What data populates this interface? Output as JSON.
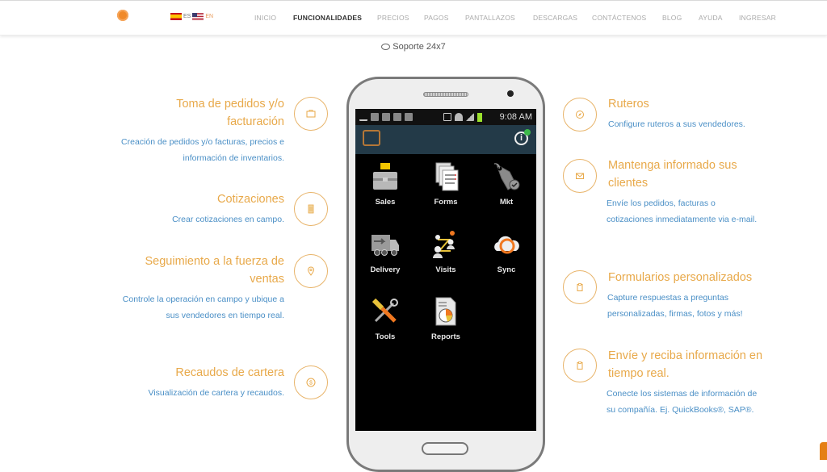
{
  "header": {
    "lang_es": "ES",
    "lang_en": "EN",
    "nav": [
      {
        "label": "INICIO",
        "active": false
      },
      {
        "label": "FUNCIONALIDADES",
        "active": true
      },
      {
        "label": "PRECIOS",
        "active": false
      },
      {
        "label": "PAGOS",
        "active": false
      },
      {
        "label": "PANTALLAZOS",
        "active": false
      },
      {
        "label": "DESCARGAS",
        "active": false
      },
      {
        "label": "CONTÁCTENOS",
        "active": false
      },
      {
        "label": "BLOG",
        "active": false
      },
      {
        "label": "AYUDA",
        "active": false
      },
      {
        "label": "INGRESAR",
        "active": false
      }
    ]
  },
  "support": {
    "label": "Soporte 24x7",
    "icon": "chat-bubble-icon"
  },
  "features_left": [
    {
      "title": "Toma de pedidos y/o facturación",
      "desc": "Creación de pedidos y/o facturas, precios e información de inventarios.",
      "icon": "briefcase-icon"
    },
    {
      "title": "Cotizaciones",
      "desc": "Crear cotizaciones en campo.",
      "icon": "calculator-icon"
    },
    {
      "title": "Seguimiento a la fuerza de ventas",
      "desc": "Controle la operación en campo y ubique a sus vendedores en tiempo real.",
      "icon": "map-pin-icon"
    },
    {
      "title": "Recaudos de cartera",
      "desc": "Visualización de cartera y recaudos.",
      "icon": "dollar-coin-icon"
    }
  ],
  "features_right": [
    {
      "title": "Ruteros",
      "desc": "Configure ruteros a sus vendedores.",
      "icon": "compass-icon"
    },
    {
      "title": "Mantenga informado sus clientes",
      "desc": "Envíe los pedidos, facturas o cotizaciones inmediatamente via e-mail.",
      "icon": "envelope-icon"
    },
    {
      "title": "Formularios personalizados",
      "desc": "Capture respuestas a preguntas personalizadas, firmas, fotos y más!",
      "icon": "clipboard-icon"
    },
    {
      "title": "Envíe y reciba información en tiempo real.",
      "desc": "Conecte los sistemas de información de su compañía. Ej. QuickBooks®, SAP®.",
      "icon": "clipboard-icon"
    }
  ],
  "phone": {
    "status_time": "9:08 AM",
    "apps": [
      {
        "label": "Sales",
        "icon": "sales-briefcase-icon"
      },
      {
        "label": "Forms",
        "icon": "forms-icon"
      },
      {
        "label": "Mkt",
        "icon": "price-tag-icon"
      },
      {
        "label": "Delivery",
        "icon": "truck-icon"
      },
      {
        "label": "Visits",
        "icon": "visits-people-icon"
      },
      {
        "label": "Sync",
        "icon": "cloud-sync-icon"
      },
      {
        "label": "Tools",
        "icon": "tools-icon"
      },
      {
        "label": "Reports",
        "icon": "report-chart-icon"
      }
    ]
  },
  "colors": {
    "accent": "#e8a94a",
    "link": "#4a8fc6",
    "brand": "#f08a2a"
  }
}
